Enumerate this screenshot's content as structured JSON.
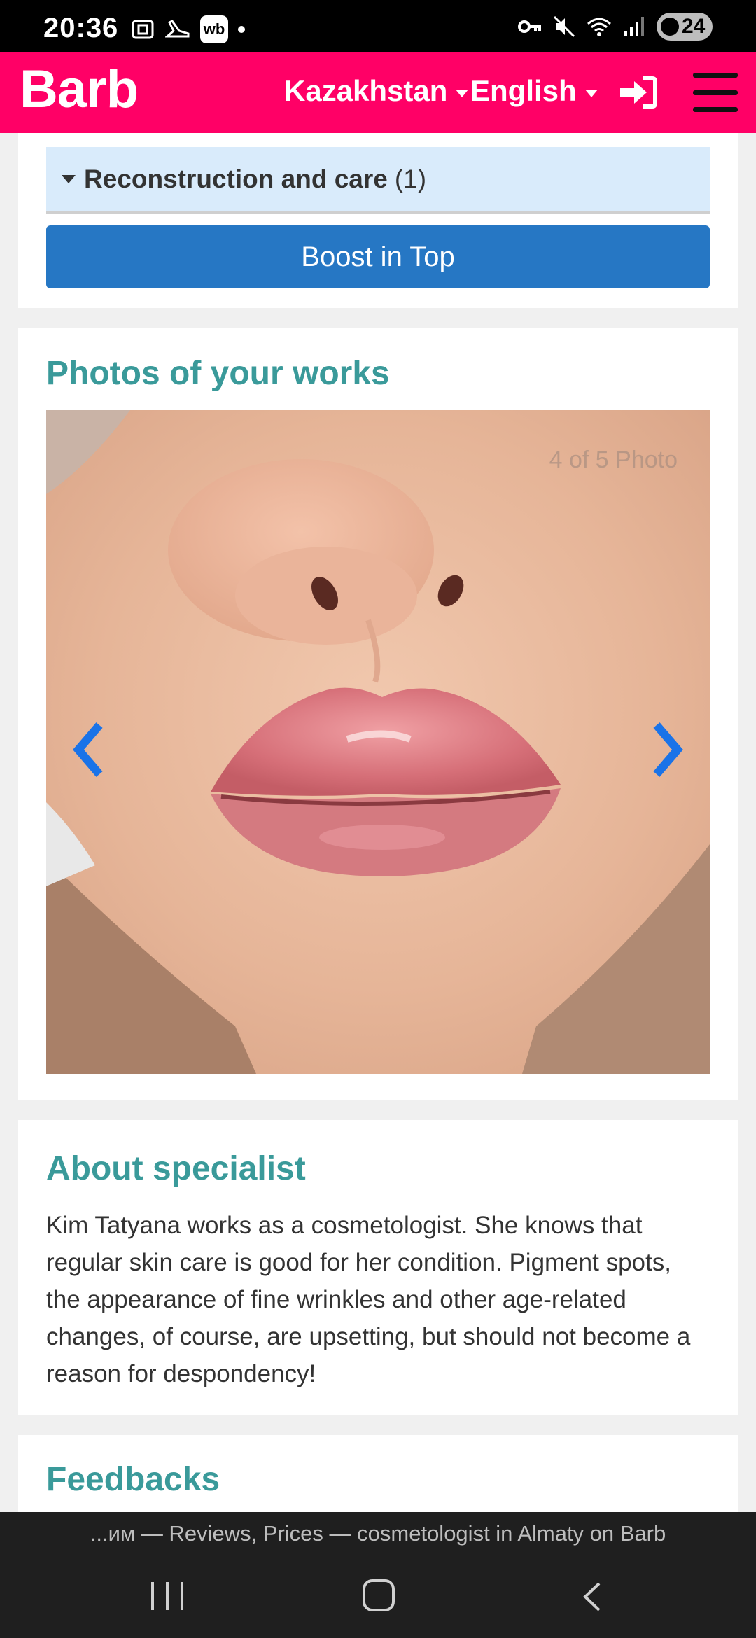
{
  "status_bar": {
    "time": "20:36",
    "left_icons": [
      "screenshot-icon",
      "running-shoe-icon",
      "wb-app-icon",
      "notification-dot-icon"
    ],
    "wb_label": "wb",
    "right_icons": [
      "vpn-key-icon",
      "mute-icon",
      "wifi-icon",
      "signal-icon"
    ],
    "battery_level": "24"
  },
  "top_nav": {
    "logo": "Barb",
    "country": "Kazakhstan",
    "language": "English",
    "login_icon": "sign-in-icon",
    "menu_icon": "hamburger-menu-icon",
    "brand_color": "#ff0066"
  },
  "services": {
    "category_label": "Reconstruction and care",
    "category_count": "(1)",
    "boost_button": "Boost in Top",
    "boost_color": "#2677c4"
  },
  "photos": {
    "title": "Photos of your works",
    "counter": "4 of 5 Photo",
    "prev_icon": "chevron-left-icon",
    "next_icon": "chevron-right-icon"
  },
  "about": {
    "title": "About specialist",
    "text": "Kim Tatyana works as a cosmetologist. She knows that regular skin care is good for her condition. Pigment spots, the appearance of fine wrinkles and other age-related changes, of course, are upsetting, but should not become a reason for despondency!"
  },
  "feedbacks": {
    "title": "Feedbacks"
  },
  "browser": {
    "page_title": "...им — Reviews, Prices — cosmetologist in Almaty on Barb"
  },
  "accent_color": "#3a9a9a"
}
